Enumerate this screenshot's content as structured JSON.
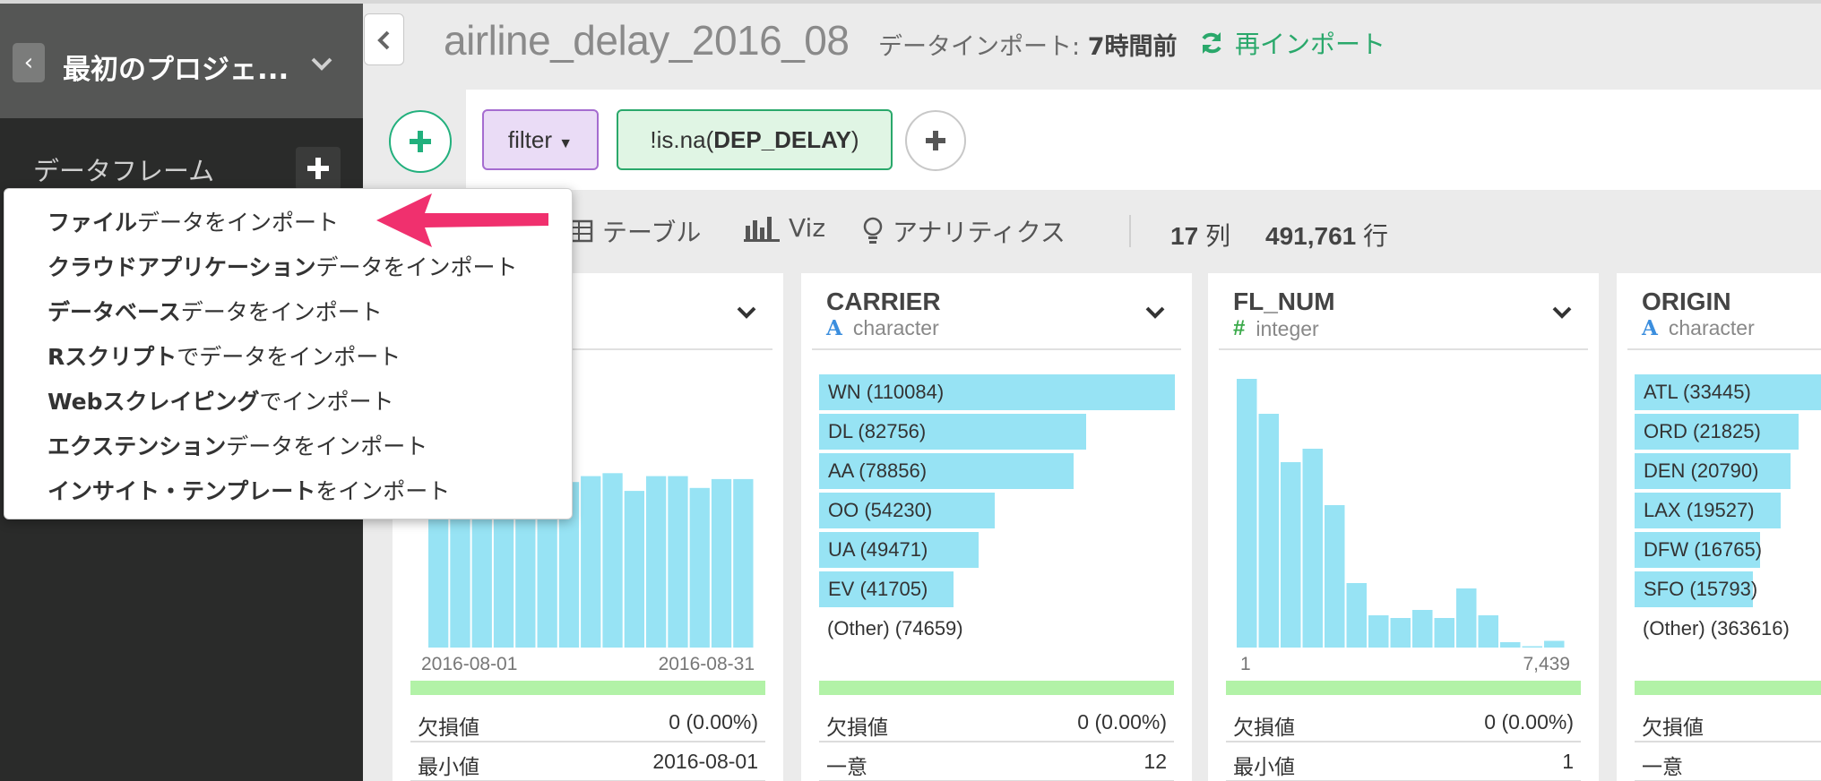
{
  "sidebar": {
    "back_icon": "chevron-left",
    "project_title": "最初のプロジェ...",
    "dataframe_label": "データフレーム",
    "add_icon": "plus"
  },
  "header": {
    "dataset_name": "airline_delay_2016_08",
    "import_prefix": "データインポート: ",
    "import_time": "7時間前",
    "reimport_label": "再インポート",
    "accent_color": "#2aa86b"
  },
  "steps": {
    "command": "filter",
    "condition_prefix": "!is.na(",
    "condition_column": "DEP_DELAY",
    "condition_suffix": ")"
  },
  "view_tabs": [
    "テーブル",
    "Viz",
    "アナリティクス"
  ],
  "summary": {
    "columns_count": "17",
    "columns_unit": "列",
    "rows_count": "491,761",
    "rows_unit": "行"
  },
  "import_menu": [
    {
      "bold": "ファイル",
      "rest": "データをインポート"
    },
    {
      "bold": "クラウドアプリケーション",
      "rest": "データをインポート"
    },
    {
      "bold": "データベース",
      "rest": "データをインポート"
    },
    {
      "bold": "Rスクリプト",
      "rest": "でデータをインポート"
    },
    {
      "bold": "Webスクレイピング",
      "rest": "でインポート"
    },
    {
      "bold": "エクステンション",
      "rest": "データをインポート"
    },
    {
      "bold": "インサイト・テンプレート",
      "rest": "をインポート"
    }
  ],
  "cards": {
    "date": {
      "axis_min": "2016-08-01",
      "axis_max": "2016-08-31",
      "stats": [
        {
          "key": "欠損値",
          "value": "0 (0.00%)"
        },
        {
          "key": "最小値",
          "value": "2016-08-01"
        }
      ]
    },
    "carrier": {
      "name": "CARRIER",
      "type": "character",
      "bars": [
        {
          "label": "WN (110084)",
          "value": 110084
        },
        {
          "label": "DL (82756)",
          "value": 82756
        },
        {
          "label": "AA (78856)",
          "value": 78856
        },
        {
          "label": "OO (54230)",
          "value": 54230
        },
        {
          "label": "UA (49471)",
          "value": 49471
        },
        {
          "label": "EV (41705)",
          "value": 41705
        }
      ],
      "other": "(Other) (74659)",
      "stats": [
        {
          "key": "欠損値",
          "value": "0 (0.00%)"
        },
        {
          "key": "一意",
          "value": "12"
        }
      ]
    },
    "fl_num": {
      "name": "FL_NUM",
      "type": "integer",
      "axis_min": "1",
      "axis_max": "7,439",
      "stats": [
        {
          "key": "欠損値",
          "value": "0 (0.00%)"
        },
        {
          "key": "最小値",
          "value": "1"
        }
      ]
    },
    "origin": {
      "name": "ORIGIN",
      "type": "character",
      "bars": [
        {
          "label": "ATL (33445)",
          "value": 33445
        },
        {
          "label": "ORD (21825)",
          "value": 21825
        },
        {
          "label": "DEN (20790)",
          "value": 20790
        },
        {
          "label": "LAX (19527)",
          "value": 19527
        },
        {
          "label": "DFW (16765)",
          "value": 16765
        },
        {
          "label": "SFO (15793)",
          "value": 15793
        }
      ],
      "other": "(Other) (363616)",
      "stats": [
        {
          "key": "欠損値",
          "value": ""
        },
        {
          "key": "一意",
          "value": ""
        }
      ]
    }
  },
  "colors": {
    "histogram": "#97e3f4",
    "missing_bar": "#b2f2a7",
    "arrow": "#f0306e"
  }
}
